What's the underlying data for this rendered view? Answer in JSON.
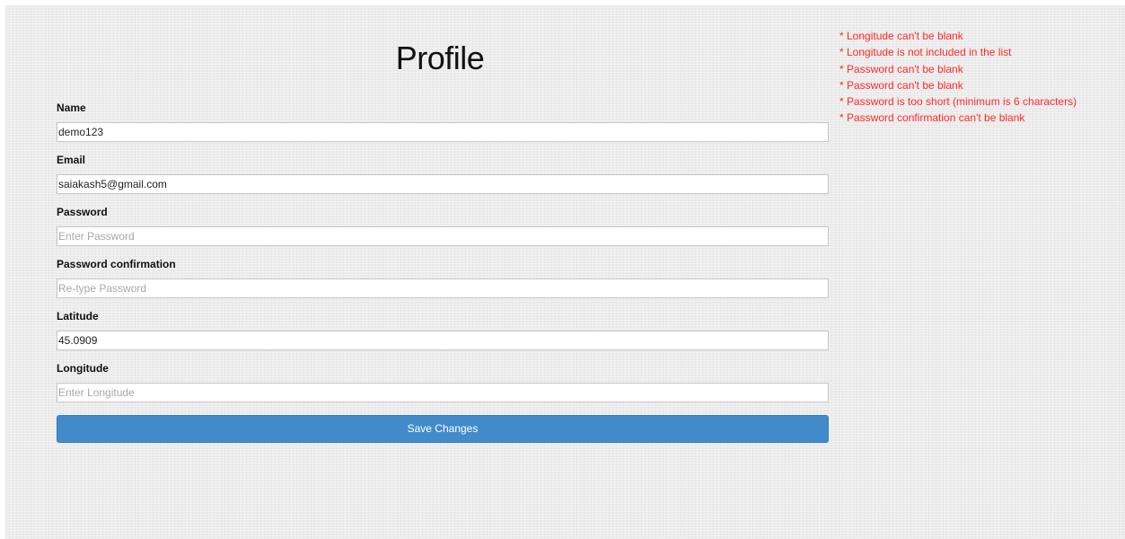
{
  "page": {
    "title": "Profile",
    "colors": {
      "error": "#ff2a2a",
      "button": "#428bca",
      "background": "#ececec"
    }
  },
  "errors": [
    "* Longitude can't be blank",
    "* Longitude is not included in the list",
    "* Password can't be blank",
    "* Password can't be blank",
    "* Password is too short (minimum is 6 characters)",
    "* Password confirmation can't be blank"
  ],
  "form": {
    "name": {
      "label": "Name",
      "value": "demo123",
      "placeholder": ""
    },
    "email": {
      "label": "Email",
      "value": "saiakash5@gmail.com",
      "placeholder": ""
    },
    "password": {
      "label": "Password",
      "value": "",
      "placeholder": "Enter Password"
    },
    "password_confirmation": {
      "label": "Password confirmation",
      "value": "",
      "placeholder": "Re-type Password"
    },
    "latitude": {
      "label": "Latitude",
      "value": "45.0909",
      "placeholder": ""
    },
    "longitude": {
      "label": "Longitude",
      "value": "",
      "placeholder": "Enter Longitude"
    },
    "submit_label": "Save Changes"
  }
}
